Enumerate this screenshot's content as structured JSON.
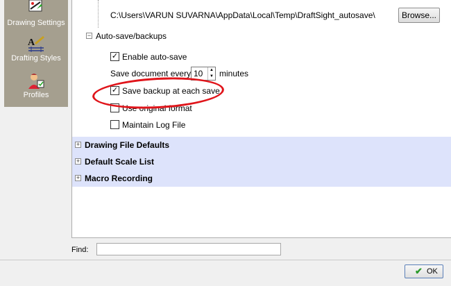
{
  "sidebar": {
    "items": [
      {
        "label": "Drawing Settings",
        "icon": "drawing-settings-icon"
      },
      {
        "label": "Drafting Styles",
        "icon": "drafting-styles-icon"
      },
      {
        "label": "Profiles",
        "icon": "profiles-icon"
      }
    ]
  },
  "autosave_path": {
    "value": "C:\\Users\\VARUN SUVARNA\\AppData\\Local\\Temp\\DraftSight_autosave\\",
    "browse_label": "Browse..."
  },
  "autosave_section": {
    "label": "Auto-save/backups",
    "enable_autosave": {
      "label": "Enable auto-save",
      "checked": true
    },
    "save_every": {
      "prefix": "Save document every",
      "value": "10",
      "suffix": "minutes"
    },
    "save_backup": {
      "label": "Save backup at each save",
      "checked": true
    },
    "original_format": {
      "label": "Use original format",
      "checked": false
    },
    "maintain_log": {
      "label": "Maintain Log File",
      "checked": false
    }
  },
  "sections": [
    {
      "label": "Drawing File Defaults"
    },
    {
      "label": "Default Scale List"
    },
    {
      "label": "Macro Recording"
    }
  ],
  "find": {
    "label": "Find:",
    "value": ""
  },
  "ok_button": {
    "label": "OK"
  },
  "colors": {
    "highlight_ellipse": "#e0141a",
    "section_bg": "#dde3fb",
    "sidebar_bg": "#a59f8f"
  }
}
